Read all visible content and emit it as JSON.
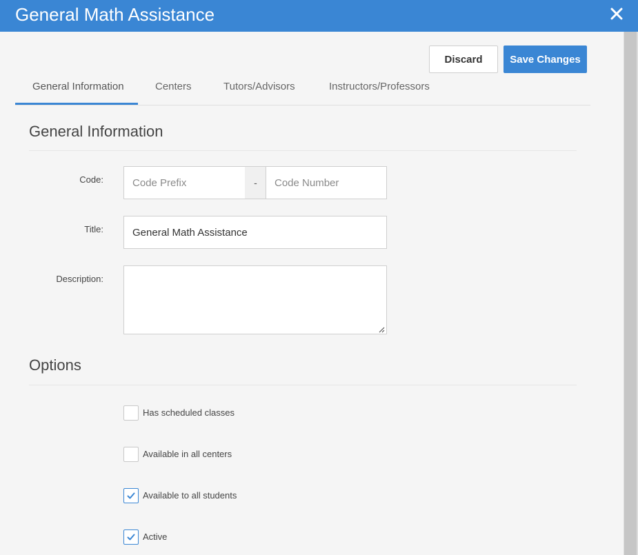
{
  "window": {
    "title": "General Math Assistance",
    "close_icon": "close-icon"
  },
  "toolbar": {
    "discard_label": "Discard",
    "save_label": "Save Changes"
  },
  "tabs": [
    {
      "label": "General Information",
      "active": true
    },
    {
      "label": "Centers",
      "active": false
    },
    {
      "label": "Tutors/Advisors",
      "active": false
    },
    {
      "label": "Instructors/Professors",
      "active": false
    }
  ],
  "general": {
    "heading": "General Information",
    "code": {
      "label": "Code:",
      "prefix_placeholder": "Code Prefix",
      "prefix_value": "",
      "separator": "-",
      "number_placeholder": "Code Number",
      "number_value": ""
    },
    "title": {
      "label": "Title:",
      "value": "General Math Assistance"
    },
    "description": {
      "label": "Description:",
      "value": ""
    }
  },
  "options": {
    "heading": "Options",
    "items": [
      {
        "label": "Has scheduled classes",
        "checked": false
      },
      {
        "label": "Available in all centers",
        "checked": false
      },
      {
        "label": "Available to all students",
        "checked": true
      },
      {
        "label": "Active",
        "checked": true
      }
    ]
  },
  "colors": {
    "accent": "#3a86d4",
    "background": "#f5f5f5",
    "border": "#cfcfcf"
  }
}
